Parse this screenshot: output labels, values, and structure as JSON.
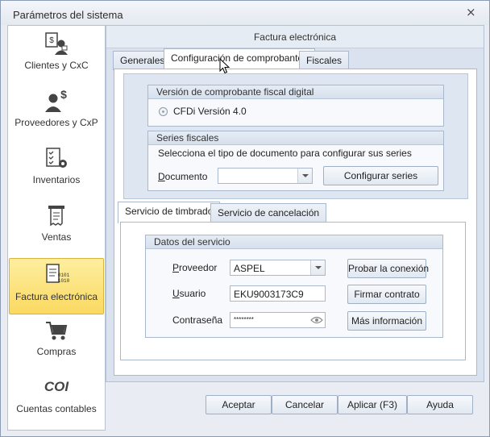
{
  "window": {
    "title": "Parámetros del sistema",
    "close_glyph": "⨯"
  },
  "sidebar": {
    "items": [
      {
        "label": "Clientes y CxC",
        "icon": "clients-money-icon"
      },
      {
        "label": "Proveedores y CxP",
        "icon": "supplier-money-icon"
      },
      {
        "label": "Inventarios",
        "icon": "inventory-checklist-icon"
      },
      {
        "label": "Ventas",
        "icon": "receipt-icon"
      },
      {
        "label": "Factura electrónica",
        "icon": "electronic-invoice-icon",
        "active": true
      },
      {
        "label": "Compras",
        "icon": "shopping-cart-icon"
      },
      {
        "label": "Cuentas contables",
        "icon": "coi-icon",
        "icon_text": "COI"
      }
    ]
  },
  "main": {
    "header": "Factura electrónica",
    "tabs": [
      "Generales",
      "Configuración de comprobantes",
      "Fiscales"
    ],
    "active_tab": "Configuración de comprobantes",
    "cfdi_group": {
      "title": "Versión de comprobante fiscal digital",
      "option_label": "CFDi Versión 4.0"
    },
    "series_group": {
      "title": "Series fiscales",
      "instruction": "Selecciona el tipo de documento para configurar sus series",
      "document_label": "Documento",
      "document_value": "",
      "configure_button": "Configurar series"
    },
    "subtabs": [
      "Servicio de timbrado",
      "Servicio de cancelación"
    ],
    "active_subtab": "Servicio de timbrado",
    "service_group": {
      "title": "Datos del servicio",
      "provider_label": "Proveedor",
      "provider_value": "ASPEL",
      "user_label": "Usuario",
      "user_value": "EKU9003173C9",
      "password_label": "Contraseña",
      "password_value": "********",
      "test_button": "Probar la conexión",
      "sign_button": "Firmar contrato",
      "more_button": "Más información"
    }
  },
  "footer": {
    "accept": "Aceptar",
    "cancel": "Cancelar",
    "apply": "Aplicar (F3)",
    "help": "Ayuda"
  },
  "colors": {
    "active_item": "#fbd961",
    "accent_blue": "#3b6aa8"
  }
}
